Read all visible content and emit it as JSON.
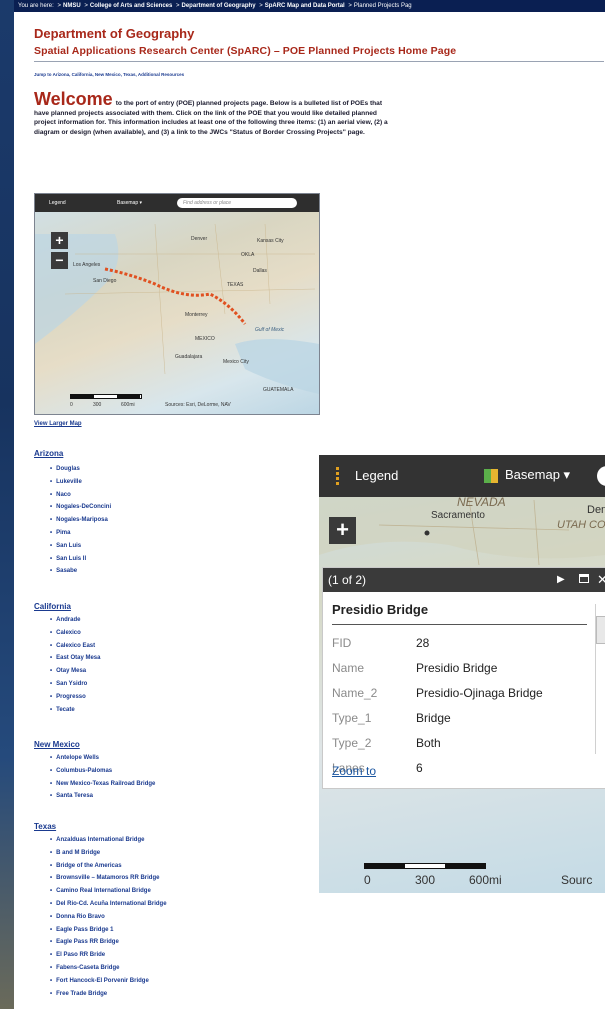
{
  "breadcrumb": {
    "prefix": "You are here:",
    "items": [
      "NMSU",
      "College of Arts and Sciences",
      "Department of Geography",
      "SpARC Map and Data Portal",
      "Planned Projects Pag"
    ]
  },
  "header": {
    "dept_title": "Department of Geography",
    "page_title": "Spatial Applications Research Center (SpARC) – POE Planned Projects Home Page",
    "jump_line": "Jump to Arizona, California, New Mexico, Texas, Additional Resources"
  },
  "welcome": {
    "big_word": "Welcome",
    "text": "to the port of entry (POE) planned projects page. Below is a bulleted list of POEs that have planned projects associated with them. Click on the link of the POE that you would like detailed planned project information for. This information includes at least one of the following three items: (1) an aerial view, (2) a diagram or design (when available), and (3) a link to the JWCs \"Status of Border Crossing Projects\" page."
  },
  "small_map": {
    "legend": "Legend",
    "basemap": "Basemap ▾",
    "search_placeholder": "Find address or place",
    "zoom_in": "+",
    "zoom_out": "−",
    "labels": {
      "la": "Los Angeles",
      "sd": "San Diego",
      "dallas": "Dallas",
      "texas": "TEXAS",
      "monterrey": "Monterrey",
      "gulf": "Gulf of Mexic",
      "mexico": "MEXICO",
      "guadalajara": "Guadalajara",
      "mexico_city": "Mexico City",
      "guatemala": "GUATEMALA",
      "denver": "Denver",
      "kansas_city": "Kansas City",
      "okla": "OKLA",
      "scale_0": "0",
      "scale_300": "300",
      "scale_600": "600mi",
      "sources": "Sources: Esri, DeLorme, NAV"
    }
  },
  "view_larger": "View Larger Map",
  "states": [
    {
      "name": "Arizona",
      "items": [
        "Douglas",
        "Lukeville",
        "Naco",
        "Nogales-DeConcini",
        "Nogales-Mariposa",
        "Pima",
        "San Luis",
        "San Luis II",
        "Sasabe"
      ]
    },
    {
      "name": "California",
      "items": [
        "Andrade",
        "Calexico",
        "Calexico East",
        "East Otay Mesa",
        "Otay Mesa",
        "San Ysidro",
        "Progresso",
        "Tecate"
      ]
    },
    {
      "name": "New Mexico",
      "items": [
        "Antelope Wells",
        "Columbus-Palomas",
        "New Mexico-Texas Railroad Bridge",
        "Santa Teresa"
      ]
    },
    {
      "name": "Texas",
      "items": [
        "Anzalduas International Bridge",
        "B and M Bridge",
        "Bridge of the Americas",
        "Brownsville – Matamoros RR Bridge",
        "Camino Real International Bridge",
        "Del Rio-Cd. Acuña International Bridge",
        "Donna Rio Bravo",
        "Eagle Pass Bridge 1",
        "Eagle Pass RR Bridge",
        "El Paso RR Bride",
        "Fabens-Caseta Bridge",
        "Fort Hancock-El Porvenir Bridge",
        "Free Trade Bridge"
      ]
    }
  ],
  "popup_map": {
    "legend": "Legend",
    "basemap": "Basemap ▾",
    "zoom_in": "+",
    "labels": {
      "nevada": "NEVADA",
      "sacramento": "Sacramento",
      "utah": "UTAH",
      "co": "CO",
      "den": "Den"
    },
    "scale_0": "0",
    "scale_300": "300",
    "scale_600": "600mi",
    "sources": "Sourc"
  },
  "popup": {
    "count": "(1 of 2)",
    "next": "▶",
    "close": "✕",
    "title": "Presidio Bridge",
    "fields": [
      {
        "key": "FID",
        "value": "28"
      },
      {
        "key": "Name",
        "value": "Presidio Bridge"
      },
      {
        "key": "Name_2",
        "value": "Presidio-Ojinaga Bridge"
      },
      {
        "key": "Type_1",
        "value": "Bridge"
      },
      {
        "key": "Type_2",
        "value": "Both"
      },
      {
        "key": "Lanes",
        "value": "6"
      }
    ],
    "zoom_to": "Zoom to"
  }
}
